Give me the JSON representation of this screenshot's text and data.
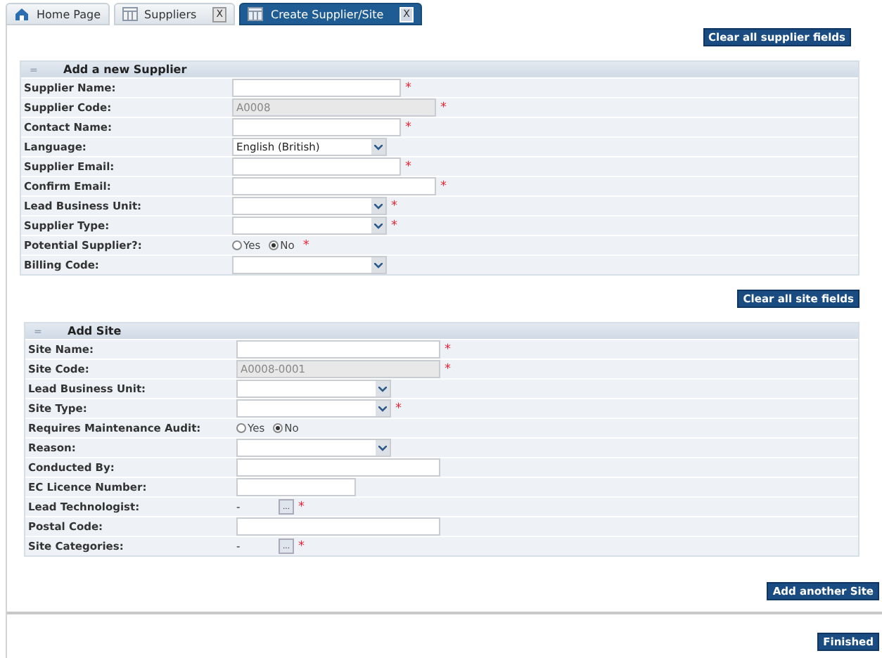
{
  "tabs": [
    {
      "label": "Home Page",
      "selected": false
    },
    {
      "label": "Suppliers",
      "close": "X",
      "selected": false
    },
    {
      "label": "Create Supplier/Site",
      "close": "X",
      "selected": true
    }
  ],
  "sections": [
    {
      "clear_button": "Clear all supplier fields",
      "title": "Add a new Supplier",
      "collapse": "=",
      "fields": [
        {
          "label": "Supplier Name:",
          "kind": "text",
          "required_mark": "*"
        },
        {
          "label": "Supplier Code:",
          "kind": "readonly",
          "value": "A0008",
          "required_mark": "*"
        },
        {
          "label": "Contact Name:",
          "kind": "text",
          "required_mark": "*"
        },
        {
          "label": "Language:",
          "kind": "select",
          "value": "English (British)"
        },
        {
          "label": "Supplier Email:",
          "kind": "text",
          "required_mark": "*"
        },
        {
          "label": "Confirm Email:",
          "kind": "wide-text",
          "required_mark": "*"
        },
        {
          "label": "Lead Business Unit:",
          "kind": "select",
          "required_mark": "*"
        },
        {
          "label": "Supplier Type:",
          "kind": "select",
          "required_mark": "*"
        },
        {
          "label": "Potential Supplier?:",
          "kind": "radio",
          "options": [
            {
              "label": "Yes",
              "selected": false
            },
            {
              "label": "No",
              "selected": true
            }
          ],
          "required_mark": "*"
        },
        {
          "label": "Billing Code:",
          "kind": "select"
        }
      ]
    },
    {
      "clear_button": "Clear all site fields",
      "title": "Add Site",
      "collapse": "=",
      "fields": [
        {
          "label": "Site Name:",
          "kind": "wide-text",
          "required_mark": "*"
        },
        {
          "label": "Site Code:",
          "kind": "readonly",
          "value": "A0008-0001",
          "required_mark": "*"
        },
        {
          "label": "Lead Business Unit:",
          "kind": "select"
        },
        {
          "label": "Site Type:",
          "kind": "select",
          "required_mark": "*"
        },
        {
          "label": "Requires Maintenance Audit:",
          "kind": "radio",
          "options": [
            {
              "label": "Yes",
              "selected": false
            },
            {
              "label": "No",
              "selected": true
            }
          ]
        },
        {
          "label": "Reason:",
          "kind": "select"
        },
        {
          "label": "Conducted By:",
          "kind": "wide-text"
        },
        {
          "label": "EC Licence Number:",
          "kind": "short-text"
        },
        {
          "label": "Lead Technologist:",
          "kind": "picker",
          "value": "-",
          "button": "...",
          "required_mark": "*"
        },
        {
          "label": "Postal Code:",
          "kind": "wide-text"
        },
        {
          "label": "Site Categories:",
          "kind": "picker",
          "value": "-",
          "button": "...",
          "required_mark": "*"
        }
      ]
    }
  ],
  "add_button": "Add another Site",
  "finish_button": "Finished"
}
